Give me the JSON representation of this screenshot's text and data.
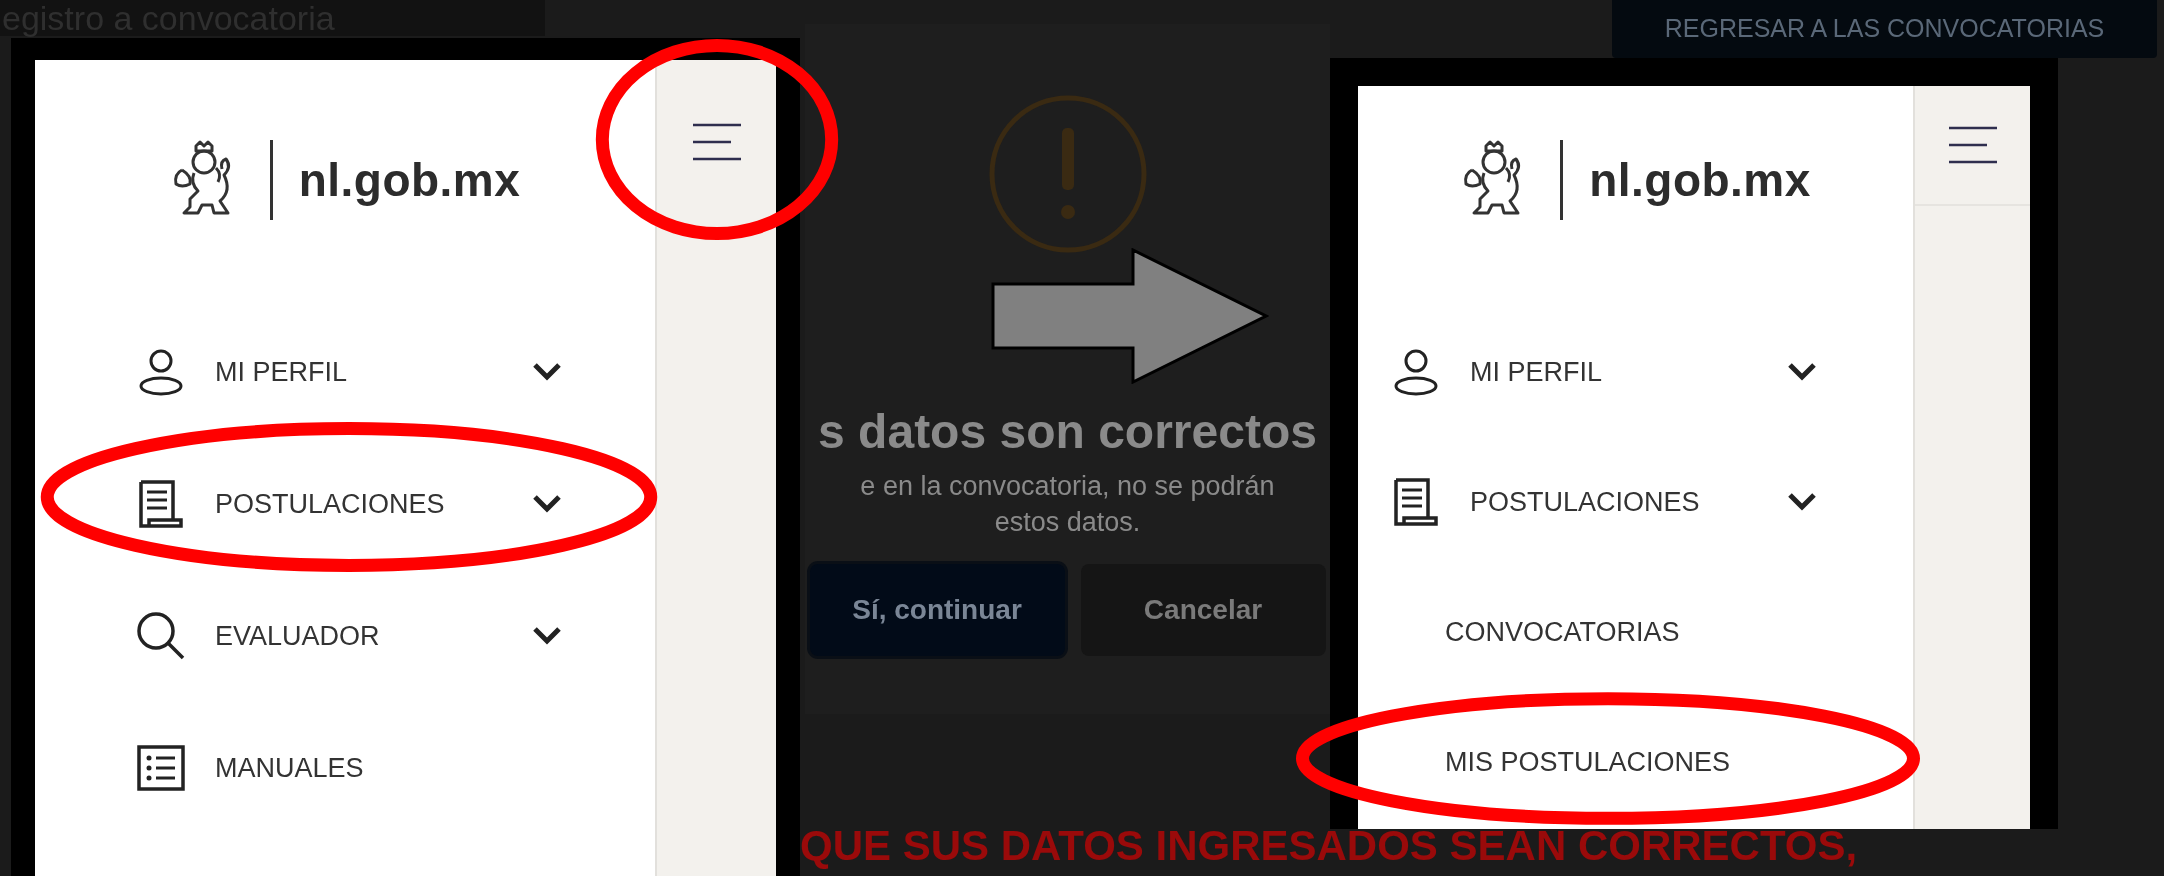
{
  "background_page": {
    "title": "egistro a convocatoria",
    "back_button": "REGRESAR A LAS CONVOCATORIAS",
    "dialog": {
      "heading": "s datos son correctos",
      "message_lines": [
        "e en la convocatoria, no se podrán",
        "estos datos."
      ],
      "buttons": [
        {
          "label": "Sí, continuar",
          "kind": "primary"
        },
        {
          "label": "Cancelar",
          "kind": "secondary"
        }
      ]
    },
    "banner_texts": [
      "QUE SUS DATOS INGRESADOS SEAN CORRECTOS,"
    ]
  },
  "arrow_between_panels": true,
  "panels": [
    {
      "logo_text": "nl.gob.mx",
      "menu_toggle": {
        "circled": true
      },
      "menu": [
        {
          "kind": "profile",
          "label": "MI PERFIL",
          "chevron": true,
          "circled": false
        },
        {
          "kind": "applications",
          "label": "POSTULACIONES",
          "chevron": true,
          "circled": true
        },
        {
          "kind": "evaluator",
          "label": "EVALUADOR",
          "chevron": true,
          "circled": false
        },
        {
          "kind": "manuals",
          "label": "MANUALES",
          "chevron": false,
          "circled": false
        }
      ]
    },
    {
      "logo_text": "nl.gob.mx",
      "menu_toggle": {
        "circled": false
      },
      "menu": [
        {
          "kind": "profile",
          "label": "MI PERFIL",
          "chevron": true,
          "circled": false
        },
        {
          "kind": "applications",
          "label": "POSTULACIONES",
          "chevron": true,
          "circled": false,
          "children": [
            {
              "label": "CONVOCATORIAS",
              "circled": false
            },
            {
              "label": "MIS POSTULACIONES",
              "circled": true
            }
          ]
        }
      ]
    }
  ]
}
